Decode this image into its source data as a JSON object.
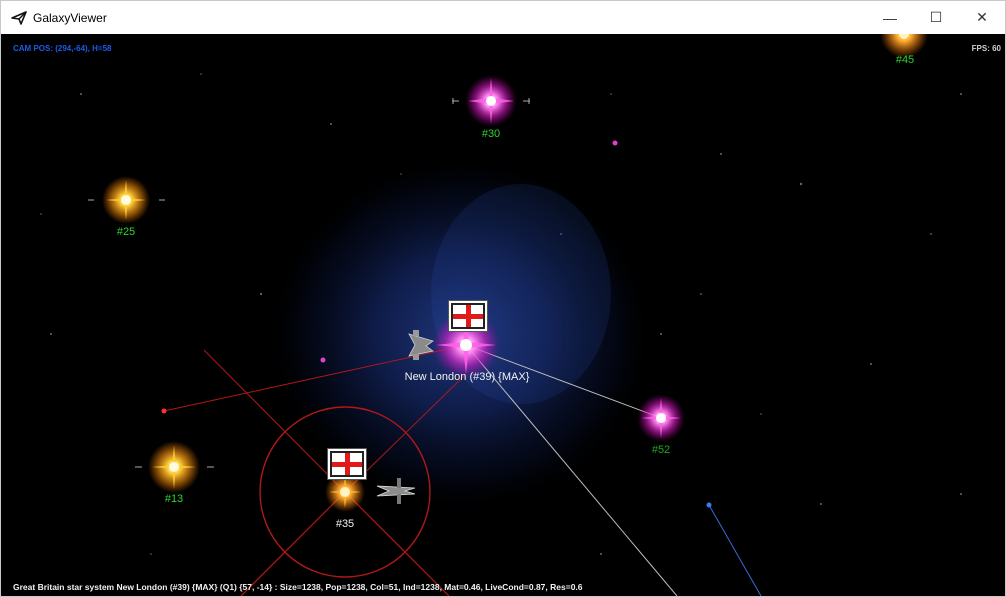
{
  "window": {
    "title": "GalaxyViewer"
  },
  "controls": {
    "minimize": "—",
    "maximize": "☐",
    "close": "✕"
  },
  "hud": {
    "cam_pos": "CAM POS: (294,-64), H=58",
    "fps": "FPS: 60",
    "status": "Great Britain star system New London (#39) {MAX} (Q1)  {57, -14} :  Size=1238, Pop=1238, Col=51, Ind=1238, Mat=0.46, LiveCond=0.87, Res=0.6"
  },
  "stars": {
    "s45": "#45",
    "s30": "#30",
    "s25": "#25",
    "s39": "New London (#39) {MAX}",
    "s52": "#52",
    "s13": "#13",
    "s35": "#35"
  },
  "colors": {
    "label_green": "#2fd52f",
    "cam_text": "#1e5be6",
    "route": "#c01818",
    "nebula": "#1c3a8a"
  }
}
